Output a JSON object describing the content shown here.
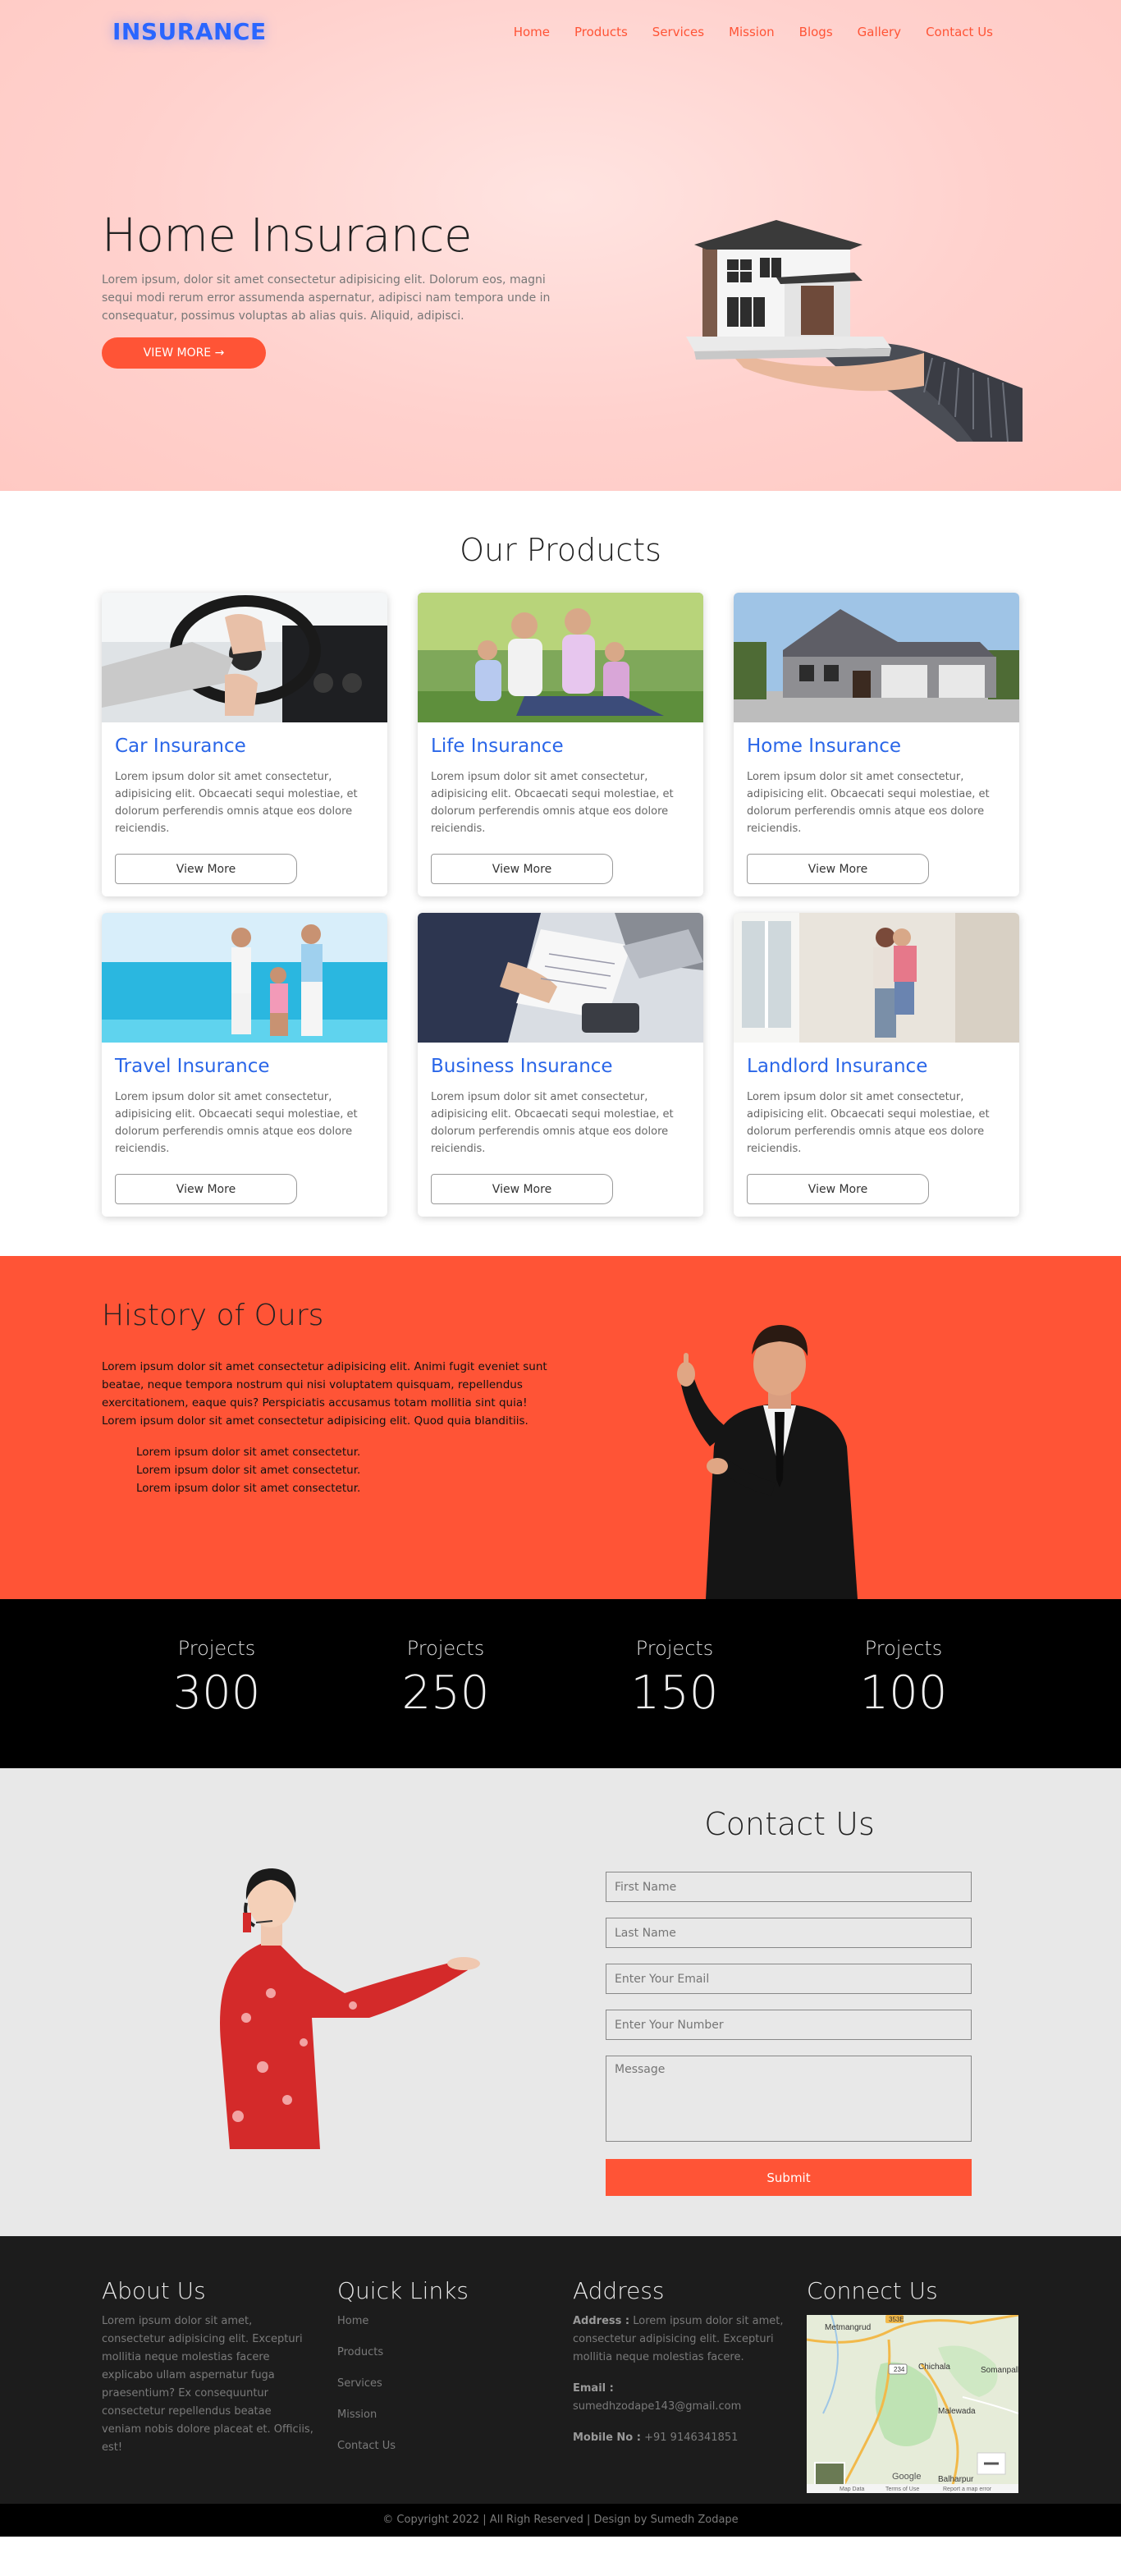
{
  "nav": {
    "logo": "INSURANCE",
    "items": [
      "Home",
      "Products",
      "Services",
      "Mission",
      "Blogs",
      "Gallery",
      "Contact Us"
    ]
  },
  "hero": {
    "title": "Home Insurance",
    "text": "Lorem ipsum, dolor sit amet consectetur adipisicing elit. Dolorum eos, magni sequi modi rerum error assumenda aspernatur, adipisci nam tempora unde in consequatur, possimus voluptas ab alias quis. Aliquid, adipisci.",
    "button": "VIEW MORE →"
  },
  "products": {
    "title": "Our Products",
    "card_text": "Lorem ipsum dolor sit amet consectetur, adipisicing elit. Obcaecati sequi molestiae, et dolorum perferendis omnis atque eos dolore reiciendis.",
    "button": "View More",
    "items": [
      {
        "title": "Car Insurance"
      },
      {
        "title": "Life Insurance"
      },
      {
        "title": "Home Insurance"
      },
      {
        "title": "Travel Insurance"
      },
      {
        "title": "Business Insurance"
      },
      {
        "title": "Landlord Insurance"
      }
    ]
  },
  "history": {
    "title": "History of Ours",
    "text": "Lorem ipsum dolor sit amet consectetur adipisicing elit. Animi fugit eveniet sunt beatae, neque tempora nostrum qui nisi voluptatem quisquam, repellendus exercitationem, eaque quis? Perspiciatis accusamus totam mollitia sint quia! Lorem ipsum dolor sit amet consectetur adipisicing elit. Quod quia blanditiis.",
    "list": [
      "Lorem ipsum dolor sit amet consectetur.",
      "Lorem ipsum dolor sit amet consectetur.",
      "Lorem ipsum dolor sit amet consectetur."
    ]
  },
  "stats": [
    {
      "label": "Projects",
      "value": "300"
    },
    {
      "label": "Projects",
      "value": "250"
    },
    {
      "label": "Projects",
      "value": "150"
    },
    {
      "label": "Projects",
      "value": "100"
    }
  ],
  "contact": {
    "title": "Contact Us",
    "first_name": "First Name",
    "last_name": "Last Name",
    "email": "Enter Your Email",
    "number": "Enter Your Number",
    "message": "Message",
    "submit": "Submit"
  },
  "footer": {
    "about_title": "About Us",
    "about_text": "Lorem ipsum dolor sit amet, consectetur adipisicing elit. Excepturi mollitia neque molestias facere explicabo ullam aspernatur fuga praesentium? Ex consequuntur consectetur repellendus beatae veniam nobis dolore placeat et. Officiis, est!",
    "links_title": "Quick Links",
    "links": [
      "Home",
      "Products",
      "Services",
      "Mission",
      "Contact Us"
    ],
    "address_title": "Address",
    "address_label": "Address :",
    "address_text": "Lorem ipsum dolor sit amet, consectetur adipisicing elit. Excepturi mollitia neque molestias facere.",
    "email_label": "Email :",
    "email_value": "sumedhzodape143@gmail.com",
    "mobile_label": "Mobile No :",
    "mobile_value": "+91 9146341851",
    "connect_title": "Connect Us",
    "map_labels": [
      "Metmangrud",
      "Chichala",
      "Somanpalli",
      "Malewada",
      "Balharpur",
      "Google",
      "Map Data",
      "Terms of Use",
      "Report a map error"
    ],
    "copyright": "© Copyright 2022 | All Righ Reserved | Design by Sumedh Zodape"
  },
  "colors": {
    "accent": "#ff5436",
    "brand_blue": "#2a66ff",
    "hero_bg": "#ffd1cd",
    "dark": "#1c1c1c"
  }
}
